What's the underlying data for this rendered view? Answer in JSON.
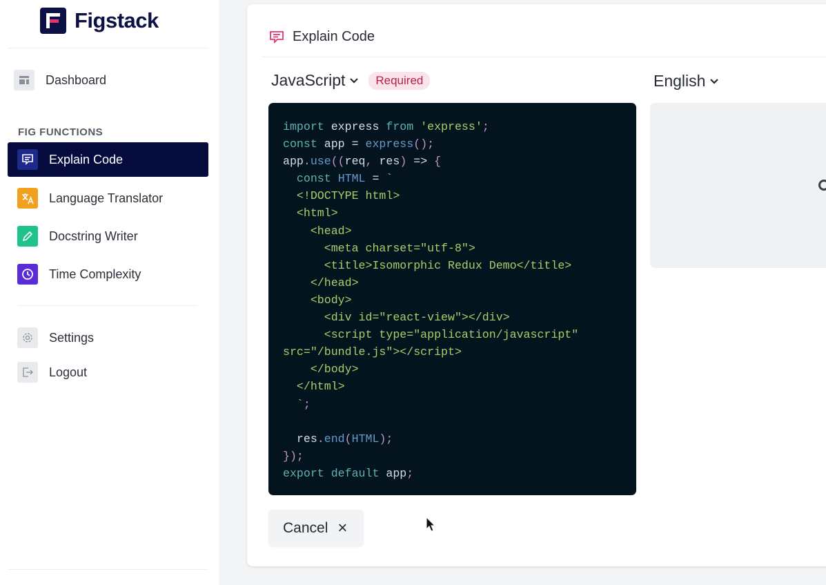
{
  "app": {
    "name": "Figstack"
  },
  "sidebar": {
    "dashboard": "Dashboard",
    "section_title": "FIG FUNCTIONS",
    "functions": [
      {
        "label": "Explain Code",
        "icon": "chat-icon",
        "color": "#1e2a8a",
        "active": true
      },
      {
        "label": "Language Translator",
        "icon": "translate-icon",
        "color": "#f2a020"
      },
      {
        "label": "Docstring Writer",
        "icon": "pencil-icon",
        "color": "#1fc28a"
      },
      {
        "label": "Time Complexity",
        "icon": "clock-icon",
        "color": "#5a2bd8"
      }
    ],
    "settings": "Settings",
    "logout": "Logout"
  },
  "main": {
    "title": "Explain Code",
    "source_language": "JavaScript",
    "required_badge": "Required",
    "output_language": "English",
    "cancel_label": "Cancel",
    "cancel_icon": "×",
    "code_lines": [
      [
        [
          "kw",
          "import"
        ],
        [
          "id",
          " express "
        ],
        [
          "kw",
          "from"
        ],
        [
          "id",
          " "
        ],
        [
          "str",
          "'express'"
        ],
        [
          "p",
          ";"
        ]
      ],
      [
        [
          "kw",
          "const"
        ],
        [
          "id",
          " app = "
        ],
        [
          "fn",
          "express"
        ],
        [
          "p",
          "();"
        ]
      ],
      [
        [
          "id",
          "app"
        ],
        [
          "p",
          "."
        ],
        [
          "fn",
          "use"
        ],
        [
          "p",
          "(("
        ],
        [
          "id",
          "req"
        ],
        [
          "p",
          ","
        ],
        [
          "id",
          " res"
        ],
        [
          "p",
          ")"
        ],
        [
          "id",
          " => "
        ],
        [
          "p",
          "{"
        ]
      ],
      [
        [
          "id",
          "  "
        ],
        [
          "kw",
          "const"
        ],
        [
          "id",
          " "
        ],
        [
          "fn",
          "HTML"
        ],
        [
          "id",
          " = "
        ],
        [
          "str",
          "`"
        ]
      ],
      [
        [
          "str",
          "  <!DOCTYPE html>"
        ]
      ],
      [
        [
          "str",
          "  <html>"
        ]
      ],
      [
        [
          "str",
          "    <head>"
        ]
      ],
      [
        [
          "str",
          "      <meta charset=\"utf-8\">"
        ]
      ],
      [
        [
          "str",
          "      <title>Isomorphic Redux Demo</title>"
        ]
      ],
      [
        [
          "str",
          "    </head>"
        ]
      ],
      [
        [
          "str",
          "    <body>"
        ]
      ],
      [
        [
          "str",
          "      <div id=\"react-view\"></div>"
        ]
      ],
      [
        [
          "str",
          "      <script type=\"application/javascript\""
        ]
      ],
      [
        [
          "str",
          "src=\"/bundle.js\"></script>"
        ]
      ],
      [
        [
          "str",
          "    </body>"
        ]
      ],
      [
        [
          "str",
          "  </html>"
        ]
      ],
      [
        [
          "str",
          "  `"
        ],
        [
          "p",
          ";"
        ]
      ],
      [
        [
          "id",
          ""
        ]
      ],
      [
        [
          "id",
          "  res"
        ],
        [
          "p",
          "."
        ],
        [
          "fn",
          "end"
        ],
        [
          "p",
          "("
        ],
        [
          "fn",
          "HTML"
        ],
        [
          "p",
          ");"
        ]
      ],
      [
        [
          "p",
          "});"
        ]
      ],
      [
        [
          "kw",
          "export"
        ],
        [
          "id",
          " "
        ],
        [
          "kw",
          "default"
        ],
        [
          "id",
          " app"
        ],
        [
          "p",
          ";"
        ]
      ]
    ]
  }
}
